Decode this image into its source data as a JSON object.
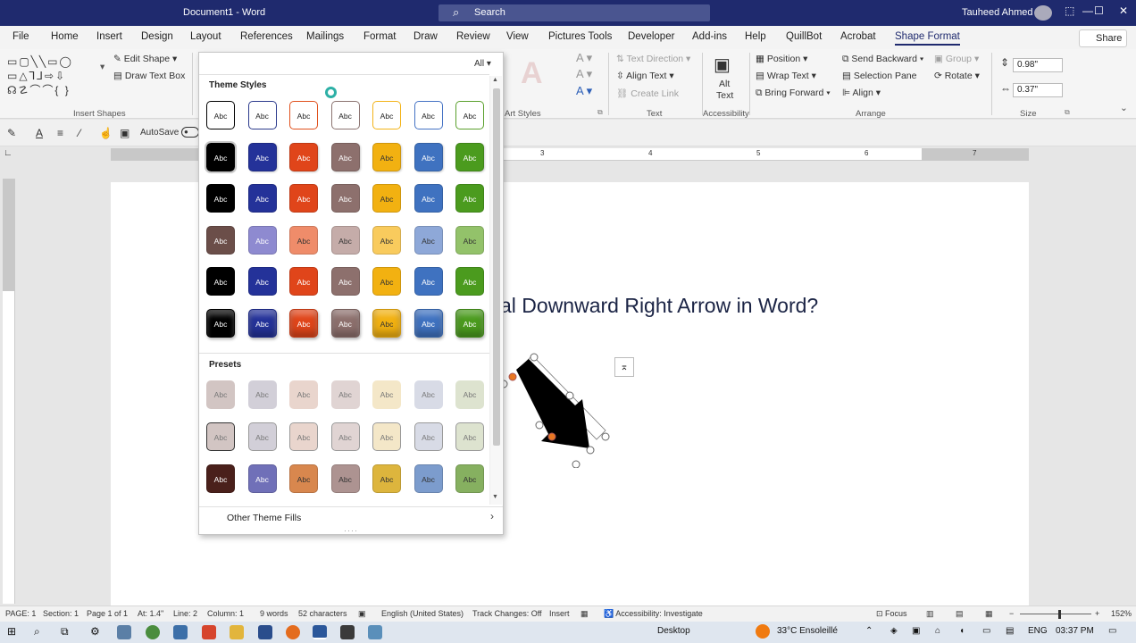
{
  "titlebar": {
    "document": "Document1 - Word",
    "search": "Search",
    "user": "Tauheed Ahmed",
    "minimize": "—",
    "maximize": "☐",
    "close": "✕",
    "ribbon_display": "⬚"
  },
  "menu": {
    "items": [
      "File",
      "Home",
      "Insert",
      "Design",
      "Layout",
      "References",
      "Mailings",
      "Format",
      "Draw",
      "Review",
      "View",
      "Pictures Tools",
      "Developer",
      "Add-ins",
      "Help",
      "QuillBot",
      "Acrobat",
      "Shape Format"
    ],
    "active": "Shape Format",
    "share": "Share"
  },
  "ribbon": {
    "insert_shapes": {
      "edit_shape": "Edit Shape",
      "draw_text_box": "Draw Text Box",
      "label": "Insert Shapes"
    },
    "wordart": {
      "label": "Art Styles"
    },
    "text": {
      "text_direction": "Text Direction",
      "align_text": "Align Text",
      "create_link": "Create Link",
      "label": "Text"
    },
    "accessibility": {
      "alt_text_line1": "Alt",
      "alt_text_line2": "Text",
      "label": "Accessibility"
    },
    "arrange": {
      "position": "Position",
      "wrap_text": "Wrap Text",
      "bring_forward": "Bring Forward",
      "send_backward": "Send Backward",
      "selection_pane": "Selection Pane",
      "align": "Align",
      "group": "Group",
      "rotate": "Rotate",
      "label": "Arrange"
    },
    "size": {
      "height": "0.98\"",
      "width": "0.37\"",
      "label": "Size"
    }
  },
  "qat": {
    "autosave": "AutoSave"
  },
  "ruler": {
    "numbers": [
      "3",
      "4",
      "5",
      "6",
      "7"
    ]
  },
  "document": {
    "heading": "al Downward Right Arrow in Word?"
  },
  "dropdown": {
    "filter": "All",
    "theme_styles_label": "Theme Styles",
    "presets_label": "Presets",
    "other_fills": "Other Theme Fills",
    "swatch_text": "Abc",
    "theme_rows": [
      {
        "style": "outline",
        "colors": [
          "#000000",
          "#2b3a8c",
          "#e0501c",
          "#8b7370",
          "#f3b318",
          "#4472c4",
          "#5aa02c"
        ]
      },
      {
        "style": "solid",
        "colors": [
          "#000000",
          "#243299",
          "#e0451a",
          "#8d706d",
          "#f2b111",
          "#3f72c0",
          "#4b9b1e"
        ]
      },
      {
        "style": "solid",
        "colors": [
          "#000000",
          "#243299",
          "#e0451a",
          "#8d706d",
          "#f2b111",
          "#3f72c0",
          "#4b9b1e"
        ]
      },
      {
        "style": "light",
        "colors": [
          "#6b4e49",
          "#8e8ad0",
          "#ef8c6a",
          "#c5aca9",
          "#f9cb5d",
          "#8ea8d8",
          "#93c26a"
        ]
      },
      {
        "style": "solid",
        "colors": [
          "#000000",
          "#243299",
          "#e0451a",
          "#8d706d",
          "#f2b111",
          "#3f72c0",
          "#4b9b1e"
        ]
      },
      {
        "style": "gloss",
        "colors": [
          "#000000",
          "#243299",
          "#e0451a",
          "#8d706d",
          "#f2b111",
          "#3f72c0",
          "#4b9b1e"
        ]
      }
    ],
    "preset_rows": [
      {
        "style": "soft",
        "colors": [
          "#d2c5c3",
          "#d2cfd8",
          "#e9d5cd",
          "#e0d4d3",
          "#f4e7c8",
          "#d8dbe6",
          "#dde3cf"
        ]
      },
      {
        "style": "soft-outline",
        "colors": [
          "#d2c5c3",
          "#d2cfd8",
          "#e9d5cd",
          "#e0d4d3",
          "#f4e7c8",
          "#d8dbe6",
          "#dde3cf"
        ]
      },
      {
        "style": "medium",
        "colors": [
          "#4a201b",
          "#7070b8",
          "#d8874e",
          "#ad9391",
          "#ddb53d",
          "#7c9ccd",
          "#86b060"
        ]
      }
    ]
  },
  "status": {
    "page": "PAGE: 1",
    "section": "Section: 1",
    "page_of": "Page 1 of 1",
    "at": "At: 1.4\"",
    "line": "Line: 2",
    "column": "Column: 1",
    "words": "9 words",
    "characters": "52 characters",
    "language": "English (United States)",
    "track": "Track Changes: Off",
    "insert": "Insert",
    "accessibility": "Accessibility: Investigate",
    "focus": "Focus",
    "zoom": "152%"
  },
  "taskbar": {
    "desktop": "Desktop",
    "weather": "33°C  Ensoleillé",
    "lang": "ENG",
    "time": "03:37 PM"
  }
}
